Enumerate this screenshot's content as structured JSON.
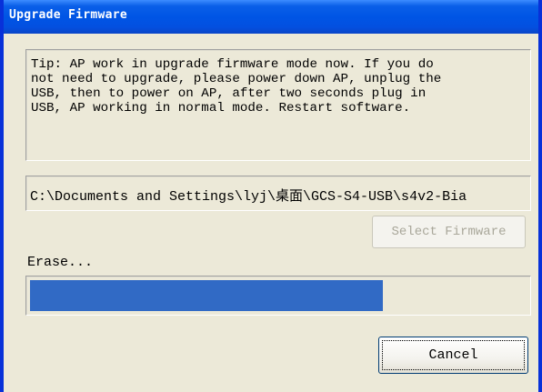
{
  "window": {
    "title": "Upgrade Firmware"
  },
  "tip": {
    "text": "Tip: AP work in upgrade firmware mode now. If you do\nnot need to upgrade, please power down AP, unplug the\nUSB, then to power on AP, after two seconds plug in\nUSB, AP working in normal mode. Restart software."
  },
  "firmware_path": {
    "value": "C:\\Documents and Settings\\lyj\\桌面\\GCS-S4-USB\\s4v2-Bia"
  },
  "buttons": {
    "select_firmware": "Select Firmware",
    "cancel": "Cancel"
  },
  "status": {
    "label": "Erase..."
  },
  "progress": {
    "fraction": 0.71
  },
  "colors": {
    "progress_fill": "#316ac5",
    "title_bar": "#0055e5"
  }
}
